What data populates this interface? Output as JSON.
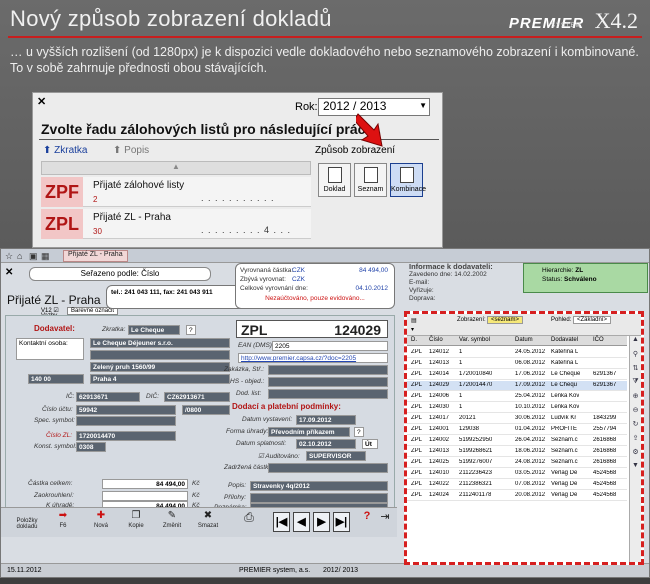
{
  "slide": {
    "title": "Nový způsob zobrazení dokladů",
    "logo_brand": "PREMIER",
    "logo_sub": "SYSTEM",
    "logo_version": "X4.2",
    "intro": "… u vyšších rozlišení (od 1280px) je k dispozici vedle dokladového nebo seznamového zobrazení i kombinované. To v sobě zahrnuje přednosti obou stávajících."
  },
  "dialog": {
    "close": "✕",
    "rok_label": "Rok:",
    "rok_value": "2012 / 2013",
    "heading": "Zvolte řadu zálohových listů pro následující práci...",
    "tab_zkratka": "⬆ Zkratka",
    "tab_popis": "⬆ Popis",
    "list_header": "▲",
    "rows": [
      {
        "code": "ZPF",
        "name": "Přijaté zálohové listy",
        "count": "2",
        "dots": ". . . . . . . . . . ."
      },
      {
        "code": "ZPL",
        "name": "Přijaté ZL - Praha",
        "count": "30",
        "dots": ". . . . . . . . . 4 . . ."
      }
    ],
    "zpusob_label": "Způsob zobrazení",
    "buttons": [
      "Doklad",
      "Seznam",
      "Kombinace"
    ]
  },
  "main": {
    "tab_label": "Přijaté ZL - Praha",
    "close": "✕",
    "serazeno": "Seřazeno podle: Číslo",
    "doc_title": "Přijaté ZL - Praha",
    "v12": "V12 ☑",
    "vazby": "Vazby",
    "barevne": "Barevné označit",
    "tel": "tel.: 241 043 111, fax: 241 043 911",
    "vyr": {
      "l1": "Vyrovnaná částka:",
      "l1v": "CZK",
      "l1r": "84 494,00",
      "l2": "Zbývá vyrovnat:",
      "l2v": "CZK",
      "l3": "Celkové vyrovnání dne:",
      "l3r": "04.10.2012",
      "red": "Nezaúčtováno, pouze evidováno..."
    },
    "info": {
      "hd": "Informace k dodavateli:",
      "l1": "Zavedeno dne:",
      "l1v": "14.02.2002",
      "l2": "E-mail:",
      "l3": "Vyřizuje:",
      "l4": "Doprava:"
    },
    "hier": {
      "l1": "Hierarchie:",
      "l1v": "ZL",
      "l2": "Status:",
      "l2v": "Schváleno"
    }
  },
  "form": {
    "dodavatel_label": "Dodavatel:",
    "zkratka_lbl": "Zkratka:",
    "zkratka_val": "Le Cheque",
    "kontaktni": "Kontaktní osoba:",
    "firma": "Le Cheque Déjeuner s.r.o.",
    "ulice": "Zelený pruh 1560/99",
    "psc": "140 00",
    "mesto": "Praha 4",
    "ic_lbl": "IČ:",
    "ic_val": "62913671",
    "dic_lbl": "DIČ:",
    "dic_val": "CZ62913671",
    "ucet_lbl": "Číslo účtu:",
    "ucet_val": "59942",
    "banka_val": "/0800",
    "spec_lbl": "Spec. symbol:",
    "cislo_zl_lbl": "Číslo ZL:",
    "cislo_zl_val": "1720014470",
    "konst_lbl": "Konst. symbol:",
    "konst_val": "0308",
    "zpl_code": "ZPL",
    "zpl_num": "124029",
    "ean_lbl": "EAN (DMS):",
    "ean_val": "2205",
    "web_val": "http://www.premier.capsa.cz/?doc=2205",
    "zakazka_lbl": "Zakázka, Stř.:",
    "hs_lbl": "HS - objed.:",
    "dodlist_lbl": "Dod. list:",
    "dodaci_hd": "Dodací a platební podmínky:",
    "datum_vyst_lbl": "Datum vystavení:",
    "datum_vyst_val": "17.09.2012",
    "forma_lbl": "Forma úhrady:",
    "forma_val": "Převodním příkazem",
    "splat_lbl": "Datum splatnosti:",
    "splat_val": "02.10.2012",
    "splat_btn": "Út",
    "audit_lbl": "☑ Auditováno:",
    "audit_val": "SUPERVISOR",
    "zadrz_lbl": "Zadržená částka:",
    "popis_lbl": "Popis:",
    "popis_val": "Stravenky 4q/2012",
    "prilohy_lbl": "Přílohy:",
    "pozn_lbl": "Poznámka:",
    "castka_lbl": "Částka celkem:",
    "castka_val": "84 494,00",
    "zaokr_lbl": "Zaokrouhlení:",
    "kuhrade_lbl": "K úhradě:",
    "kuhrade_val": "84 494,00",
    "kc": "Kč"
  },
  "bottom": {
    "polozky": "Položky dokladu",
    "f6": "F6",
    "nova": "Nová",
    "f3": "F3",
    "kopie": "Kopie",
    "f4": "F4",
    "zmenit": "Změnit",
    "smazat": "Smazat",
    "nav": [
      "|◀",
      "◀",
      "▶",
      "▶|"
    ]
  },
  "status": {
    "date": "15.11.2012",
    "company": "PREMIER system, a.s.",
    "year": "2012/ 2013"
  },
  "grid": {
    "zobrazeni_lbl": "Zobrazení:",
    "zobrazeni_val": "<seznam>",
    "pohled_lbl": "Pohled:",
    "pohled_val": "<Základní>",
    "headers": [
      "D.",
      "Číslo",
      "Var. symbol",
      "Datum",
      "Dodavatel",
      "IČO"
    ],
    "rows": [
      [
        "ZPL",
        "124012",
        "1",
        "24.05.2012",
        "Kateřina L",
        ""
      ],
      [
        "ZPL",
        "124013",
        "1",
        "06.08.2012",
        "Kateřina L",
        ""
      ],
      [
        "ZPL",
        "124014",
        "1720010840",
        "17.06.2012",
        "Le Cheque",
        "6291367"
      ],
      [
        "ZPL",
        "124029",
        "1720014470",
        "17.09.2012",
        "Le Chequ",
        "6291367"
      ],
      [
        "ZPL",
        "124006",
        "1",
        "25.04.2012",
        "Lenka Kov",
        ""
      ],
      [
        "ZPL",
        "124030",
        "1",
        "10.10.2012",
        "Lenka Kov",
        ""
      ],
      [
        "ZPL",
        "124017",
        "20121",
        "30.06.2012",
        "Ludvík Kr",
        "1843299"
      ],
      [
        "ZPL",
        "124001",
        "129038",
        "01.04.2012",
        "PROFITE",
        "2557794"
      ],
      [
        "ZPL",
        "124002",
        "5199252950",
        "26.04.2012",
        "Seznam.c",
        "2616868"
      ],
      [
        "ZPL",
        "124013",
        "5199268621",
        "18.06.2012",
        "Seznam.c",
        "2616868"
      ],
      [
        "ZPL",
        "124025",
        "5199276007",
        "24.08.2012",
        "Seznam.c",
        "2616868"
      ],
      [
        "ZPL",
        "124010",
        "2112236423",
        "03.05.2012",
        "Verlag De",
        "4524568"
      ],
      [
        "ZPL",
        "124022",
        "2112386321",
        "07.08.2012",
        "Verlag De",
        "4524568"
      ],
      [
        "ZPL",
        "124024",
        "2112401178",
        "20.08.2012",
        "Verlag De",
        "4524568"
      ]
    ],
    "selected_row": 3
  }
}
